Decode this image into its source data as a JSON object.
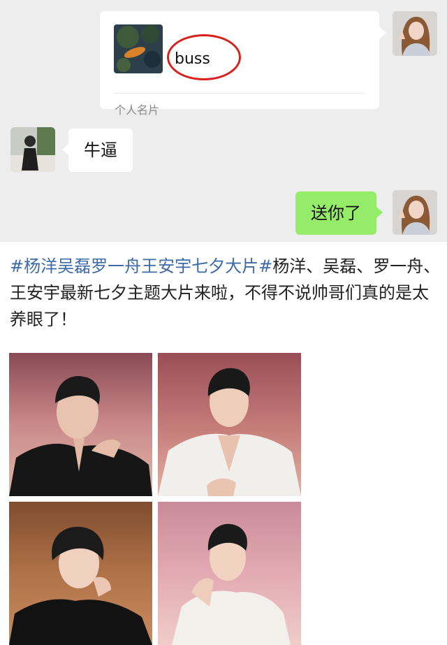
{
  "chat": {
    "card": {
      "name": "buss",
      "footer": "个人名片"
    },
    "incoming_message": "牛逼",
    "outgoing_message": "送你了"
  },
  "post": {
    "hashtag": "#杨洋吴磊罗一舟王安宇七夕大片#",
    "text": "杨洋、吴磊、罗一舟、王安宇最新七夕主题大片来啦，不得不说帅哥们真的是太养眼了！"
  },
  "colors": {
    "chat_background": "#ededed",
    "outgoing_bubble": "#95ec69",
    "hashtag": "#3e6ba8",
    "highlight_circle": "#d9221f"
  },
  "photos": [
    {
      "icon": "portrait-photo-black-suit"
    },
    {
      "icon": "portrait-photo-white-suit"
    },
    {
      "icon": "portrait-photo-black-shirt"
    },
    {
      "icon": "portrait-photo-white-blazer"
    }
  ]
}
